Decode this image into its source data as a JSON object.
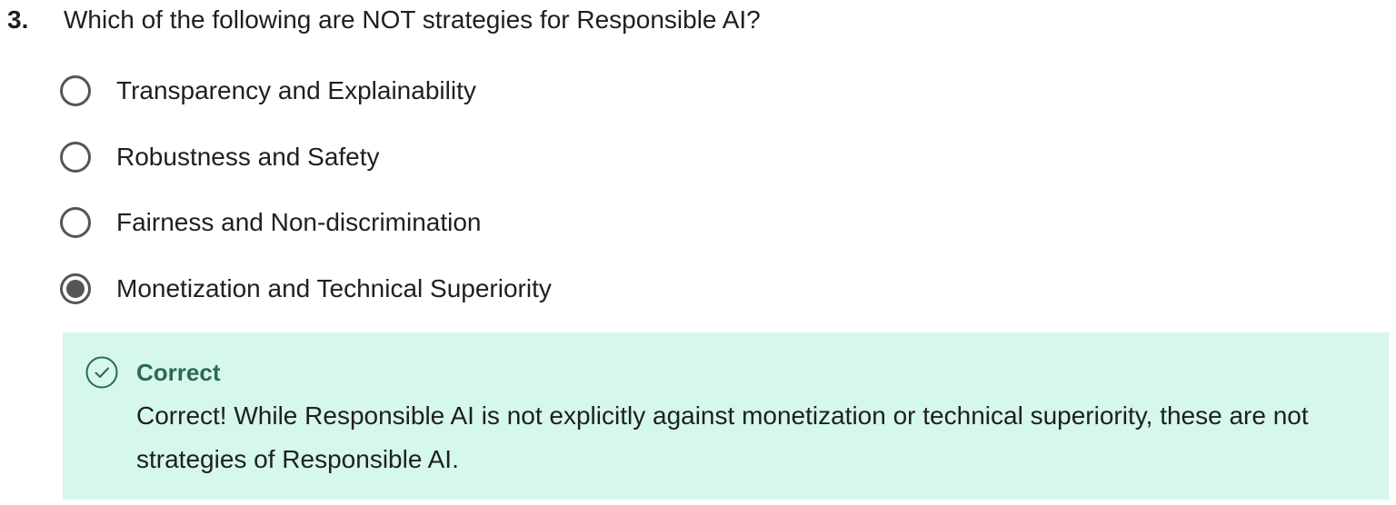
{
  "question": {
    "number": "3.",
    "text": "Which of the following are NOT strategies for Responsible AI?"
  },
  "options": [
    {
      "label": "Transparency and Explainability",
      "selected": false
    },
    {
      "label": "Robustness and Safety",
      "selected": false
    },
    {
      "label": "Fairness and Non-discrimination",
      "selected": false
    },
    {
      "label": "Monetization and Technical Superiority",
      "selected": true
    }
  ],
  "feedback": {
    "title": "Correct",
    "text": "Correct! While Responsible AI is not explicitly against monetization or technical superiority, these are not strategies of Responsible AI.",
    "icon": "check-circle-icon",
    "background_color": "#d5f7ec",
    "accent_color": "#2c6a4f"
  }
}
